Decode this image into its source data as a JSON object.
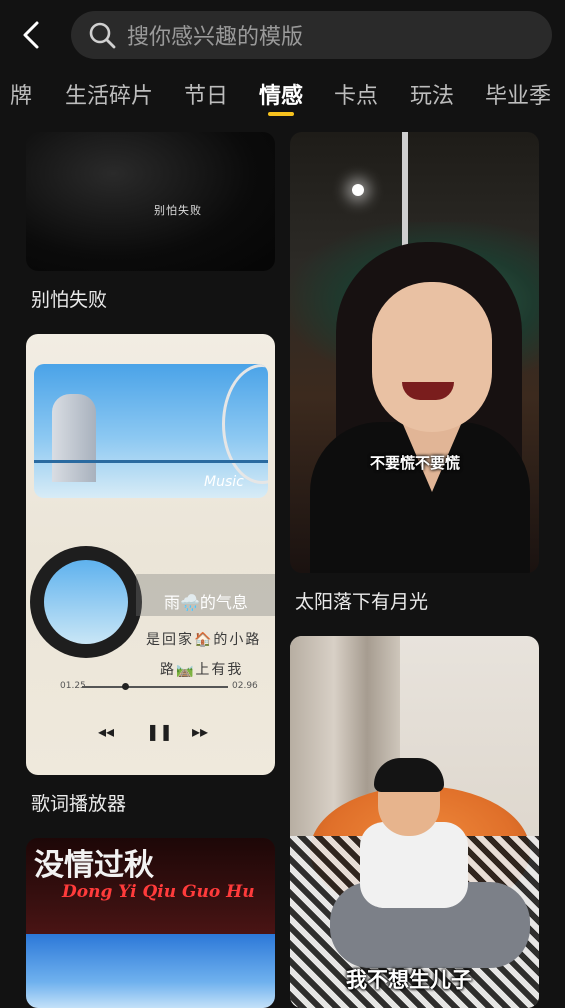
{
  "search": {
    "placeholder": "搜你感兴趣的模版"
  },
  "tabs": [
    {
      "label": "牌"
    },
    {
      "label": "生活碎片"
    },
    {
      "label": "节日"
    },
    {
      "label": "情感",
      "active": true
    },
    {
      "label": "卡点"
    },
    {
      "label": "玩法"
    },
    {
      "label": "毕业季"
    }
  ],
  "accent_color": "#f7c21e",
  "cards": {
    "card1": {
      "title": "别怕失败",
      "overlay_text": "别怕失败"
    },
    "card2": {
      "title": "歌词播放器",
      "music_label": "Music",
      "lyric_line1": "雨🌧️的气息",
      "lyric_line2": "是回家🏠的小路",
      "lyric_line3": "路🛤️上有我",
      "time_start": "01.25",
      "time_end": "02.96",
      "rewind": "◂◂",
      "pause": "❚❚",
      "forward": "▸▸"
    },
    "card3": {
      "overlay_title": "没情过秋",
      "overlay_sub": "Dong Yi Qiu Guo Hu"
    },
    "card4": {
      "title": "太阳落下有月光",
      "caption": "不要慌不要慌"
    },
    "card5": {
      "caption": "我不想生儿子"
    }
  }
}
